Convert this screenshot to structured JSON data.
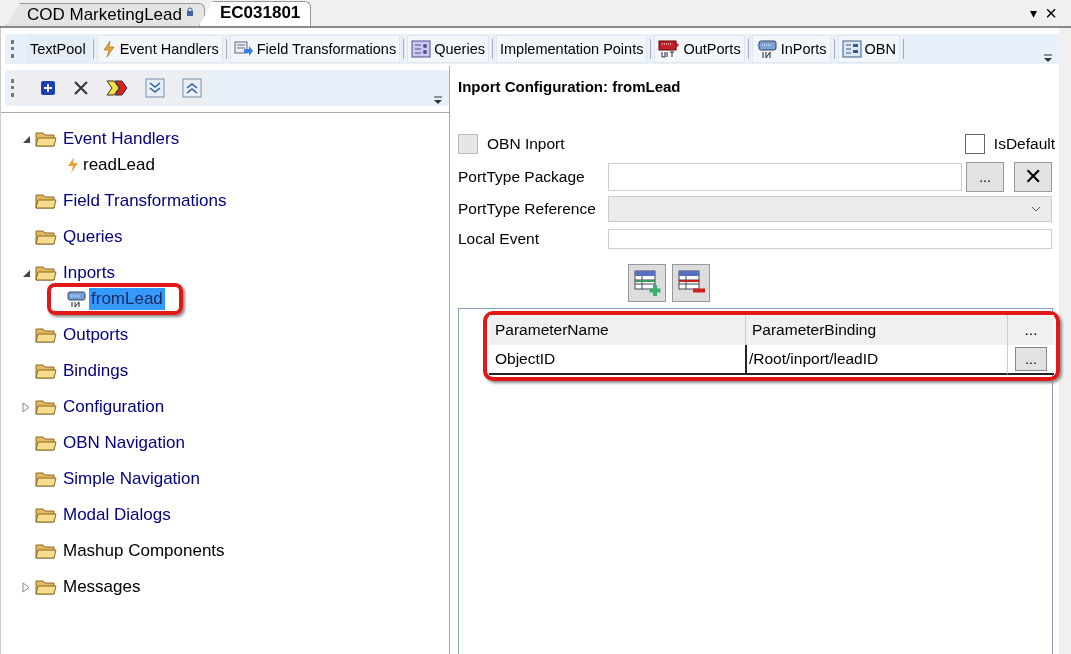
{
  "doc_tabs": [
    {
      "label": "COD MarketingLead",
      "selected": false,
      "locked": true
    },
    {
      "label": "EC031801",
      "selected": true,
      "locked": false
    }
  ],
  "tab_controls": {
    "menu": "▾",
    "close": "×"
  },
  "toolbar": [
    {
      "label": "TextPool",
      "kind": "none",
      "selected": true
    },
    {
      "label": "Event Handlers",
      "kind": "lightning",
      "selected": false
    },
    {
      "label": "Field Transformations",
      "kind": "transform",
      "selected": false
    },
    {
      "label": "Queries",
      "kind": "queries",
      "selected": false
    },
    {
      "label": "Implementation Points",
      "kind": "none",
      "selected": false
    },
    {
      "label": "OutPorts",
      "kind": "outport",
      "selected": false
    },
    {
      "label": "InPorts",
      "kind": "inport",
      "selected": false
    },
    {
      "label": "OBN",
      "kind": "obn",
      "selected": false
    }
  ],
  "tree": [
    {
      "label": "Event Handlers",
      "kind": "folder",
      "color": "#000080",
      "expanded": true,
      "selected": false,
      "children": [
        {
          "label": "readLead",
          "kind": "handler",
          "color": "#000000",
          "selected": false
        }
      ]
    },
    {
      "label": "Field Transformations",
      "kind": "folder",
      "color": "#000080",
      "selected": false
    },
    {
      "label": "Queries",
      "kind": "folder",
      "color": "#000080",
      "selected": false
    },
    {
      "label": "Inports",
      "kind": "folder",
      "color": "#000080",
      "expanded": true,
      "selected": false,
      "children": [
        {
          "label": "fromLead",
          "kind": "inport",
          "selected": true,
          "highlighted": true
        }
      ]
    },
    {
      "label": "Outports",
      "kind": "folder",
      "color": "#000080",
      "selected": false
    },
    {
      "label": "Bindings",
      "kind": "folder",
      "color": "#000080",
      "selected": false
    },
    {
      "label": "Configuration",
      "kind": "folder",
      "color": "#000080",
      "expanded": false,
      "selected": false
    },
    {
      "label": "OBN Navigation",
      "kind": "folder",
      "color": "#000080",
      "selected": false
    },
    {
      "label": "Simple Navigation",
      "kind": "folder",
      "color": "#000080",
      "selected": false
    },
    {
      "label": "Modal Dialogs",
      "kind": "folder",
      "color": "#000080",
      "selected": false
    },
    {
      "label": "Mashup Components",
      "kind": "folder",
      "color": "#000000",
      "selected": false
    },
    {
      "label": "Messages",
      "kind": "folder",
      "color": "#000000",
      "expanded": false,
      "selected": false
    }
  ],
  "panel": {
    "title": "Inport Configuration: fromLead",
    "obn_inport": {
      "label": "OBN Inport",
      "checked": false,
      "disabled": true
    },
    "is_default": {
      "label": "IsDefault",
      "checked": false,
      "disabled": false
    },
    "porttype_package": {
      "label": "PortType Package",
      "browse": "...",
      "clear": "✕"
    },
    "porttype_reference": {
      "label": "PortType Reference",
      "disabled": true
    },
    "local_event": {
      "label": "Local Event"
    },
    "table": {
      "highlighted": true,
      "columns": [
        "ParameterName",
        "ParameterBinding",
        "..."
      ],
      "rows": [
        {
          "cells": [
            "ObjectID",
            "/Root/inport/leadID"
          ],
          "button": "..."
        }
      ]
    }
  }
}
